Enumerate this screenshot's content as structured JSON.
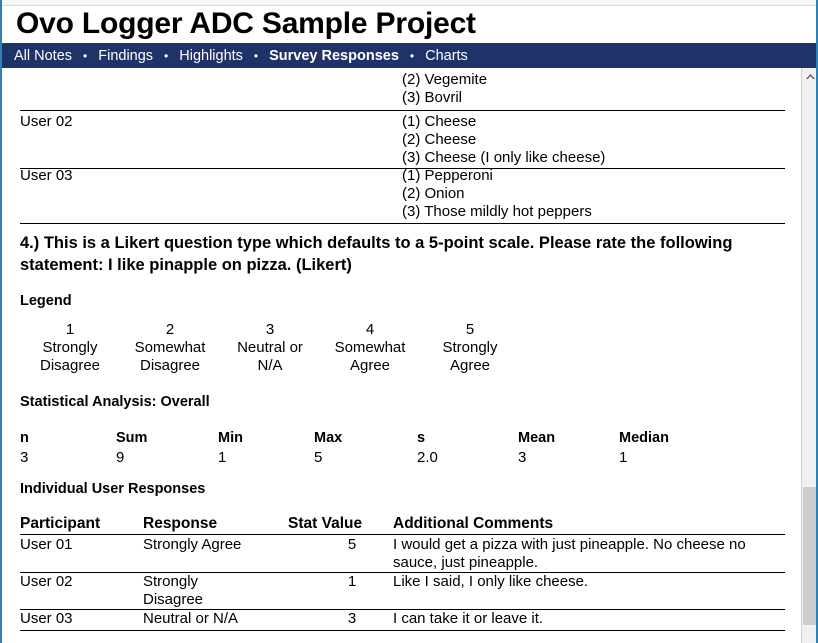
{
  "window": {
    "title": "Ovo Logger ADC Sample Project",
    "accent_border": "#2f80b4",
    "nav_background": "#1f3368"
  },
  "nav": {
    "separator": "•",
    "items": [
      {
        "label": "All Notes",
        "active": false
      },
      {
        "label": "Findings",
        "active": false
      },
      {
        "label": "Highlights",
        "active": false
      },
      {
        "label": "Survey Responses",
        "active": true
      },
      {
        "label": "Charts",
        "active": false
      }
    ]
  },
  "scrollbar": {
    "up_arrow_icon": "chevron-up-icon"
  },
  "previous_question_table": {
    "rows": [
      {
        "participant": "",
        "answers": [
          "(2) Vegemite",
          "(3) Bovril"
        ]
      },
      {
        "participant": "User 02",
        "answers": [
          "(1) Cheese",
          "(2) Cheese",
          "(3) Cheese (I only like cheese)"
        ]
      },
      {
        "participant": "User 03",
        "answers": [
          "(1) Pepperoni",
          "(2) Onion",
          "(3) Those mildly hot peppers"
        ]
      }
    ]
  },
  "question": {
    "heading": "4.) This is a Likert question type which defaults to a 5-point scale. Please rate the following statement: I like pinapple on pizza. (Likert)"
  },
  "legend": {
    "title": "Legend",
    "items": [
      {
        "value": "1",
        "label_line1": "Strongly",
        "label_line2": "Disagree"
      },
      {
        "value": "2",
        "label_line1": "Somewhat",
        "label_line2": "Disagree"
      },
      {
        "value": "3",
        "label_line1": "Neutral or",
        "label_line2": "N/A"
      },
      {
        "value": "4",
        "label_line1": "Somewhat",
        "label_line2": "Agree"
      },
      {
        "value": "5",
        "label_line1": "Strongly",
        "label_line2": "Agree"
      }
    ]
  },
  "statistics": {
    "title": "Statistical Analysis: Overall",
    "headers": [
      "n",
      "Sum",
      "Min",
      "Max",
      "s",
      "Mean",
      "Median"
    ],
    "values": [
      "3",
      "9",
      "1",
      "5",
      "2.0",
      "3",
      "1"
    ]
  },
  "responses": {
    "title": "Individual User Responses",
    "headers": [
      "Participant",
      "Response",
      "Stat Value",
      "Additional Comments"
    ],
    "rows": [
      {
        "participant": "User 01",
        "response_line1": "Strongly Agree",
        "response_line2": "",
        "stat_value": "5",
        "comment": "I would get a pizza with just pineapple. No cheese no sauce, just pineapple."
      },
      {
        "participant": "User 02",
        "response_line1": "Strongly",
        "response_line2": "Disagree",
        "stat_value": "1",
        "comment": "Like I said, I only like cheese."
      },
      {
        "participant": "User 03",
        "response_line1": "Neutral or N/A",
        "response_line2": "",
        "stat_value": "3",
        "comment": "I can take it or leave it."
      }
    ]
  }
}
